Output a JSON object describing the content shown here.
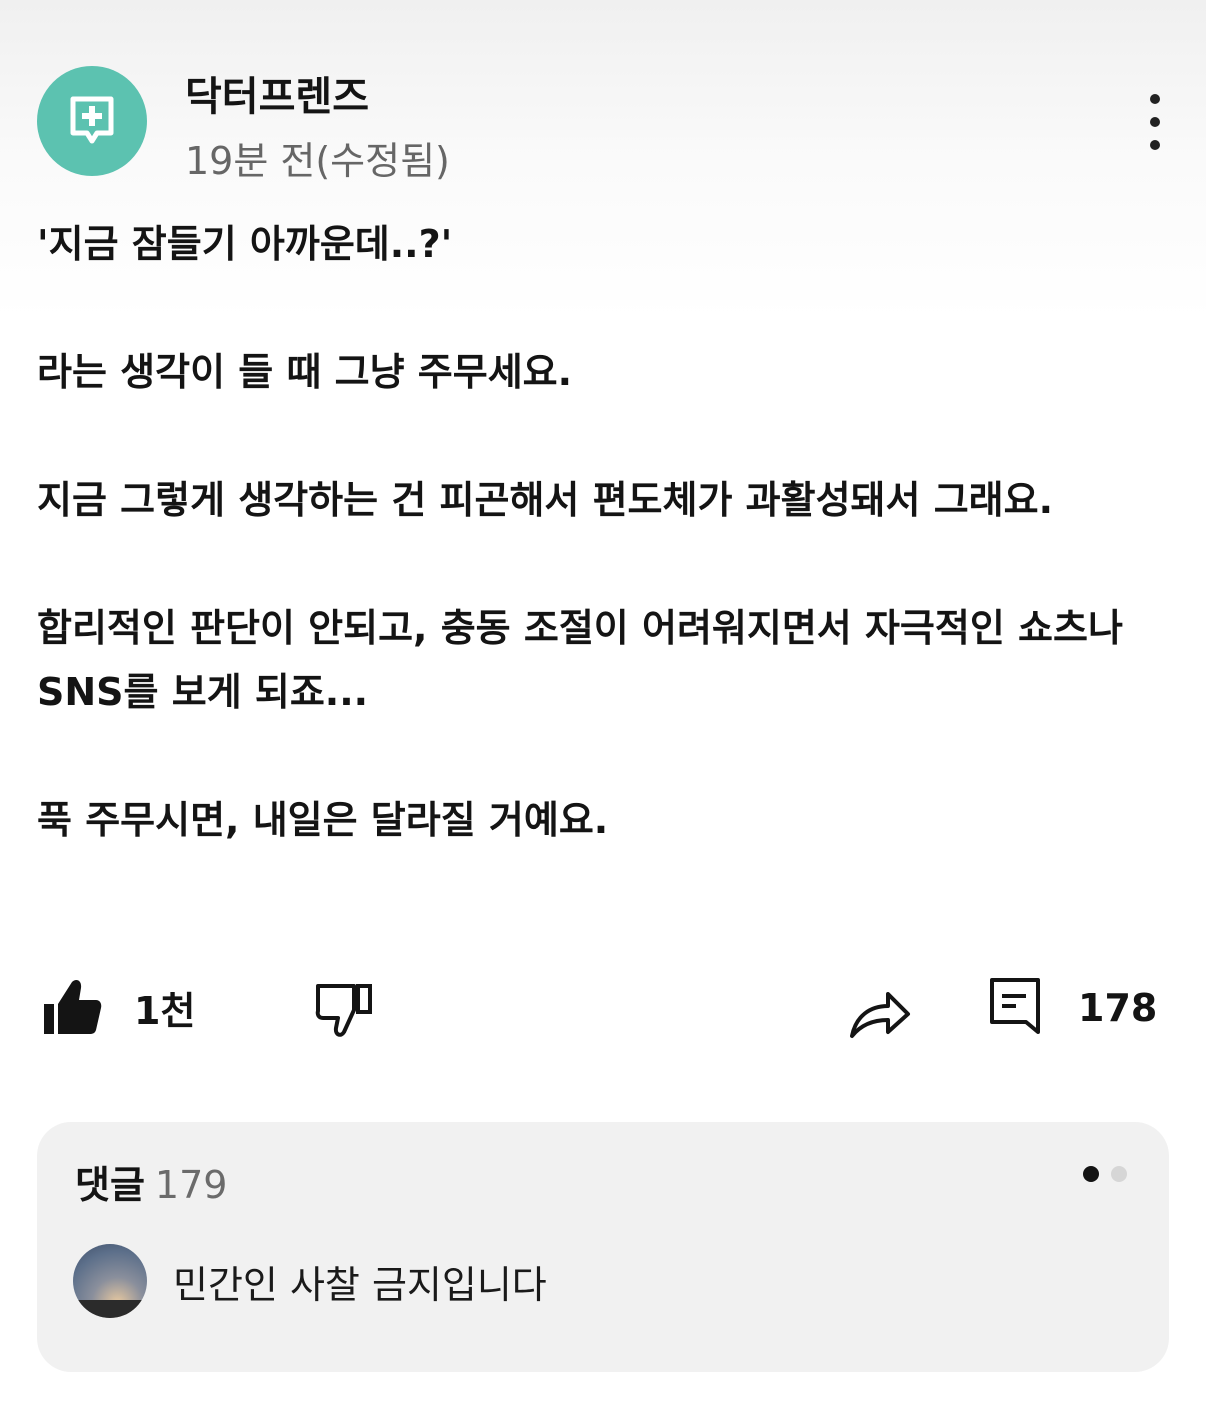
{
  "channel": {
    "name": "닥터프렌즈",
    "timestamp": "19분 전(수정됨)",
    "avatar_color": "#5cc2b0"
  },
  "post": {
    "paragraphs": [
      "'지금 잠들기 아까운데..?'",
      "라는 생각이 들 때 그냥 주무세요.",
      "지금 그렇게 생각하는 건 피곤해서 편도체가 과활성돼서 그래요.",
      "합리적인 판단이 안되고, 충동 조절이 어려워지면서 자극적인 쇼츠나 SNS를 보게 되죠...",
      "푹 주무시면, 내일은 달라질 거예요."
    ]
  },
  "actions": {
    "like_icon": "thumbs-up-filled-icon",
    "like_count": "1천",
    "dislike_icon": "thumbs-down-outline-icon",
    "share_icon": "share-arrow-icon",
    "comment_icon": "comment-icon",
    "comment_count": "178"
  },
  "comments": {
    "title": "댓글",
    "count": "179",
    "pager_active_color": "#141414",
    "pager_inactive_color": "#d6d6d6",
    "top_comment": {
      "text": "민간인 사찰 금지입니다"
    }
  }
}
